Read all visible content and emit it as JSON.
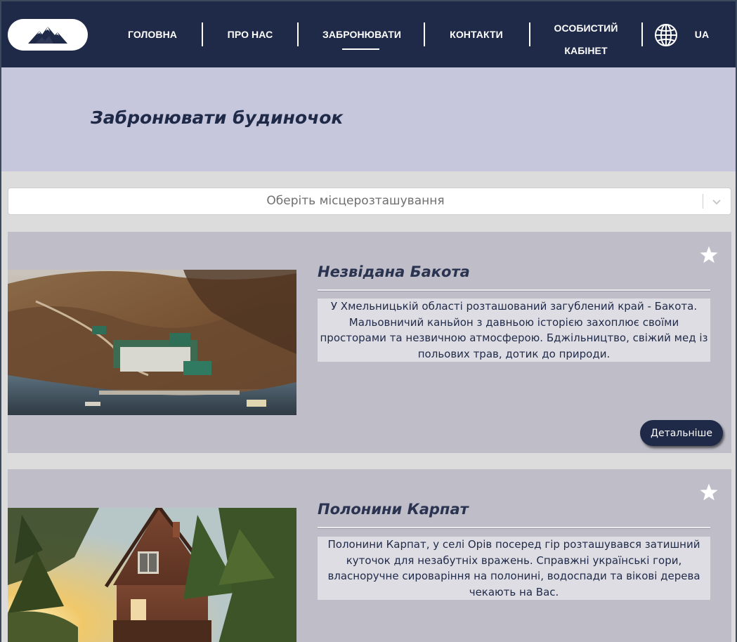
{
  "header": {
    "logo_icon": "mountains-logo-icon",
    "nav": [
      {
        "label": "ГОЛОВНА"
      },
      {
        "label": "ПРО НАС"
      },
      {
        "label": "ЗАБРОНЮВАТИ",
        "active": true
      },
      {
        "label": "КОНТАКТИ"
      },
      {
        "label_line1": "ОСОБИСТИЙ",
        "label_line2": "КАБІНЕТ"
      }
    ],
    "language_icon": "globe-icon",
    "language": "UA"
  },
  "page_title": "Забронювати будиночок",
  "location_select": {
    "placeholder": "Оберіть місцерозташування",
    "icon": "chevron-down-icon"
  },
  "cards": [
    {
      "title": "Незвідана Бакота",
      "description": "У Хмельницькій області розташований загублений край - Бакота. Мальовничий каньйон з давньою історією захоплює своїми просторами та незвичною атмосферою. Бджільництво, свіжий мед із польових трав, дотик до природи.",
      "favorite_icon": "star-icon",
      "details_label": "Детальніше"
    },
    {
      "title": "Полонини Карпат",
      "description": "Полонини Карпат, у селі Орів посеред гір розташувався затишний куточок для незабутніх вражень. Справжні українські гори, власноручне сироваріння на полонині, водоспади та вікові дерева чекають на Вас.",
      "favorite_icon": "star-icon"
    }
  ],
  "colors": {
    "header_bg": "#1f2a48",
    "title_band": "#c6c7dc",
    "page_bg": "#dcdcdc",
    "card_bg": "#bebdc8"
  }
}
